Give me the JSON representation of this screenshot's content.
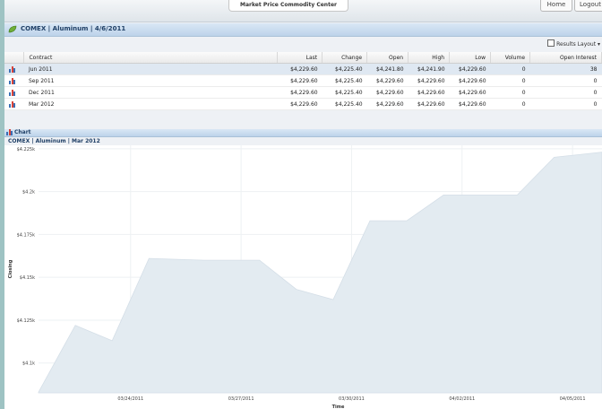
{
  "topbar": {
    "center_label": "Market Price Commodity Center",
    "home_label": "Home",
    "logout_label": "Logout"
  },
  "header": {
    "title": "COMEX | Aluminum | 4/6/2011"
  },
  "results_layout_label": "Results Layout ▾",
  "table": {
    "columns": [
      "Contract",
      "Last",
      "Change",
      "Open",
      "High",
      "Low",
      "Volume",
      "Open Interest"
    ],
    "rows": [
      [
        "Jun 2011",
        "$4,229.60",
        "$4,225.40",
        "$4,241.80",
        "$4,241.90",
        "$4,229.60",
        "0",
        "38"
      ],
      [
        "Sep 2011",
        "$4,229.60",
        "$4,225.40",
        "$4,229.60",
        "$4,229.60",
        "$4,229.60",
        "0",
        "0"
      ],
      [
        "Dec 2011",
        "$4,229.60",
        "$4,225.40",
        "$4,229.60",
        "$4,229.60",
        "$4,229.60",
        "0",
        "0"
      ],
      [
        "Mar 2012",
        "$4,229.60",
        "$4,225.40",
        "$4,229.60",
        "$4,229.60",
        "$4,229.60",
        "0",
        "0"
      ]
    ]
  },
  "chart_section": {
    "label": "Chart",
    "subtitle": "COMEX | Aluminum | Mar 2012"
  },
  "colors": {
    "accent": "#1f3f66",
    "area_fill": "#e3ebf1",
    "grid": "#eef1f3"
  },
  "chart_data": {
    "type": "area",
    "ylabel": "Closing",
    "xlabel": "Time",
    "yticks": [
      "$4.225k",
      "$4.2k",
      "$4.175k",
      "$4.15k",
      "$4.125k",
      "$4.1k"
    ],
    "ytick_values": [
      4225,
      4200,
      4175,
      4150,
      4125,
      4100
    ],
    "ylim": [
      4082.6,
      4227
    ],
    "xticks": [
      "03/24/2011",
      "03/27/2011",
      "03/30/2011",
      "04/02/2011",
      "04/05/2011"
    ],
    "xtick_positions": [
      2,
      5,
      8,
      11,
      14
    ],
    "xlim": [
      -0.5,
      14.8
    ],
    "x": [
      -0.5,
      0.5,
      1.5,
      2.5,
      4.0,
      5.5,
      6.5,
      7.5,
      8.5,
      9.5,
      10.5,
      11.5,
      12.5,
      13.5,
      14.8
    ],
    "y": [
      4083,
      4122,
      4113,
      4161,
      4160,
      4160,
      4143,
      4137,
      4183,
      4183,
      4198,
      4198,
      4198,
      4220,
      4223
    ]
  }
}
